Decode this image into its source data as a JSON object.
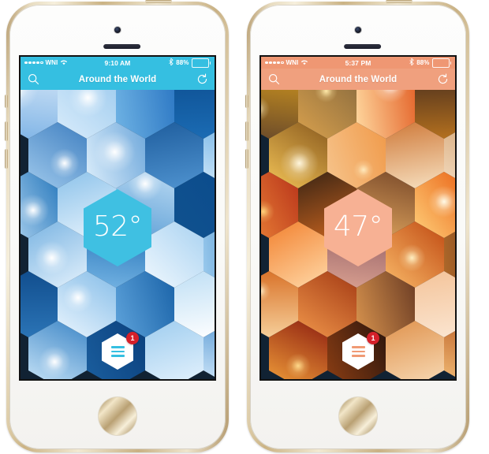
{
  "app": {
    "title": "Around the World",
    "search_icon": "search-icon",
    "refresh_icon": "refresh-icon",
    "menu_icon": "hamburger-menu-icon",
    "badge_count": "1"
  },
  "phones": [
    {
      "id": "phone-left-blue",
      "theme": "daytime-blue",
      "accent": "#31bde0",
      "navbar_color": "#35bfe1",
      "statusbar_color": "#35bfe1",
      "status": {
        "signal_dots": [
          true,
          true,
          true,
          true,
          false
        ],
        "carrier": "WNI",
        "wifi_icon": "wifi-icon",
        "time": "9:10 AM",
        "bluetooth_icon": "bluetooth-icon",
        "battery_percent": "88%",
        "battery_level": 88
      },
      "title": "Around the World",
      "temperature": "52°",
      "temp_badge_color": "#3fc0e2",
      "menu_bar_color": "#35bfe1",
      "badge_count": "1",
      "badge_color": "#d5202a",
      "tiles": [
        {
          "name": "sun-flare-tile",
          "c1": "#cfe3f6",
          "c2": "#7fb4e6",
          "sun": "28% 24%",
          "sunsize": 40,
          "suncolor": "#ffffff"
        },
        {
          "name": "bright-sun-cloud-tile",
          "c1": "#9ecbee",
          "c2": "#d9ecfb",
          "sun": "52% 38%",
          "sunsize": 34,
          "suncolor": "#ffffff"
        },
        {
          "name": "blue-sky-clouds-tile",
          "c1": "#2d78c4",
          "c2": "#6fb3e4",
          "sun": "",
          "sunsize": 0,
          "suncolor": "#ffffff"
        },
        {
          "name": "deep-blue-tile",
          "c1": "#0d4f92",
          "c2": "#1b6cb4",
          "sun": "",
          "sunsize": 0,
          "suncolor": "#ffffff"
        },
        {
          "name": "sunburst-cloud-tile",
          "c1": "#3f7fc0",
          "c2": "#9fc9ec",
          "sun": "62% 62%",
          "sunsize": 26,
          "suncolor": "#ffffff"
        },
        {
          "name": "sun-behind-cloud-tile",
          "c1": "#6fa8db",
          "c2": "#dceefb",
          "sun": "48% 45%",
          "sunsize": 36,
          "suncolor": "#ffffff"
        },
        {
          "name": "dark-cloud-sky-tile",
          "c1": "#1f5e9e",
          "c2": "#4f93d0",
          "sun": "",
          "sunsize": 0,
          "suncolor": "#ffffff"
        },
        {
          "name": "wispy-cloud-tile",
          "c1": "#63a9e0",
          "c2": "#cfe8fa",
          "sun": "",
          "sunsize": 0,
          "suncolor": "#ffffff"
        },
        {
          "name": "sun-rays-tile",
          "c1": "#2a7abd",
          "c2": "#bcdcf5",
          "sun": "58% 58%",
          "sunsize": 28,
          "suncolor": "#ffffff"
        },
        {
          "name": "cloud-field-tile",
          "c1": "#8cc2ea",
          "c2": "#e8f4fd",
          "sun": "",
          "sunsize": 0,
          "suncolor": "#ffffff"
        },
        {
          "name": "gradient-sky-tile",
          "c1": "#b9d9f2",
          "c2": "#5d9fd6",
          "sun": "50% 18%",
          "sunsize": 30,
          "suncolor": "#ffffff"
        },
        {
          "name": "navy-block-tile",
          "c1": "#0b4b8c",
          "c2": "#10528f",
          "sun": "",
          "sunsize": 0,
          "suncolor": "#ffffff"
        },
        {
          "name": "sunshine-cloud-tile",
          "c1": "#7ab4e2",
          "c2": "#e3f1fc",
          "sun": "40% 55%",
          "sunsize": 30,
          "suncolor": "#ffffff"
        },
        {
          "name": "clear-blue-tile",
          "c1": "#1f6fb5",
          "c2": "#74b3e3",
          "sun": "",
          "sunsize": 0,
          "suncolor": "#ffffff"
        },
        {
          "name": "soft-cloud-tile",
          "c1": "#a9d2f1",
          "c2": "#f0f8fe",
          "sun": "",
          "sunsize": 0,
          "suncolor": "#ffffff"
        },
        {
          "name": "sky-horizon-tile",
          "c1": "#2f7cbe",
          "c2": "#9ccbee",
          "sun": "70% 35%",
          "sunsize": 24,
          "suncolor": "#ffffff"
        },
        {
          "name": "deep-sky-tile",
          "c1": "#114e8e",
          "c2": "#2b74b6",
          "sun": "",
          "sunsize": 0,
          "suncolor": "#ffffff"
        },
        {
          "name": "cloud-burst-tile",
          "c1": "#86bde8",
          "c2": "#eaf5fe",
          "sun": "35% 40%",
          "sunsize": 26,
          "suncolor": "#ffffff"
        },
        {
          "name": "azure-tile",
          "c1": "#1a63a8",
          "c2": "#5ea3db",
          "sun": "",
          "sunsize": 0,
          "suncolor": "#ffffff"
        },
        {
          "name": "white-cloud-tile",
          "c1": "#bfdff5",
          "c2": "#ffffff",
          "sun": "",
          "sunsize": 0,
          "suncolor": "#ffffff"
        },
        {
          "name": "horizon-glow-tile",
          "c1": "#3d86c6",
          "c2": "#cbe6f9",
          "sun": "45% 62%",
          "sunsize": 28,
          "suncolor": "#ffffff"
        },
        {
          "name": "midnight-blue-tile",
          "c1": "#0a3f7c",
          "c2": "#1b5f9f",
          "sun": "",
          "sunsize": 0,
          "suncolor": "#ffffff"
        },
        {
          "name": "pale-sky-tile",
          "c1": "#9fcdef",
          "c2": "#e6f3fd",
          "sun": "",
          "sunsize": 0,
          "suncolor": "#ffffff"
        },
        {
          "name": "sunlit-cloud-tile",
          "c1": "#4b90ce",
          "c2": "#d4eafb",
          "sun": "60% 30%",
          "sunsize": 22,
          "suncolor": "#ffffff"
        }
      ]
    },
    {
      "id": "phone-right-orange",
      "theme": "sunset-orange",
      "accent": "#f0906a",
      "navbar_color": "#f0a07e",
      "statusbar_color": "#ef9773",
      "status": {
        "signal_dots": [
          true,
          true,
          true,
          true,
          false
        ],
        "carrier": "WNI",
        "wifi_icon": "wifi-icon",
        "time": "5:37 PM",
        "bluetooth_icon": "bluetooth-icon",
        "battery_percent": "88%",
        "battery_level": 88
      },
      "title": "Around the World",
      "temperature": "47°",
      "temp_badge_color": "#f7b194",
      "menu_bar_color": "#f09a74",
      "badge_count": "1",
      "badge_color": "#d5202a",
      "tiles": [
        {
          "name": "palm-sunset-tile",
          "c1": "#c9911f",
          "c2": "#6a4a2a",
          "sun": "30% 55%",
          "sunsize": 22,
          "suncolor": "#fff3c8"
        },
        {
          "name": "pier-sunset-tile",
          "c1": "#8a6b3e",
          "c2": "#d9a14d",
          "sun": "48% 28%",
          "sunsize": 20,
          "suncolor": "#ffe9a8"
        },
        {
          "name": "ocean-sunburst-tile",
          "c1": "#e4642a",
          "c2": "#ffd9a0",
          "sun": "58% 18%",
          "sunsize": 32,
          "suncolor": "#ffffff"
        },
        {
          "name": "dark-palm-tile",
          "c1": "#4b2f1d",
          "c2": "#b5711f",
          "sun": "",
          "sunsize": 0,
          "suncolor": "#ffffff"
        },
        {
          "name": "golden-sun-tile",
          "c1": "#8a5a1e",
          "c2": "#f2c356",
          "sun": "52% 62%",
          "sunsize": 34,
          "suncolor": "#fff6dd"
        },
        {
          "name": "amber-sky-tile",
          "c1": "#f09a4a",
          "c2": "#f6c48c",
          "sun": "62% 72%",
          "sunsize": 18,
          "suncolor": "#ffe9bc"
        },
        {
          "name": "cloud-fire-tile",
          "c1": "#cf7a3a",
          "c2": "#f7e0c0",
          "sun": "",
          "sunsize": 0,
          "suncolor": "#ffffff"
        },
        {
          "name": "beach-dusk-tile",
          "c1": "#d0a070",
          "c2": "#f4dcc0",
          "sun": "",
          "sunsize": 0,
          "suncolor": "#ffffff"
        },
        {
          "name": "red-horizon-tile",
          "c1": "#b8341a",
          "c2": "#ef8a3a",
          "sun": "40% 60%",
          "sunsize": 20,
          "suncolor": "#ffd27a"
        },
        {
          "name": "palm-silhouette-tile",
          "c1": "#3a2414",
          "c2": "#c9641f",
          "sun": "68% 78%",
          "sunsize": 22,
          "suncolor": "#ffc96a"
        },
        {
          "name": "dusk-water-tile",
          "c1": "#7a4a2a",
          "c2": "#e0a55e",
          "sun": "",
          "sunsize": 0,
          "suncolor": "#ffffff"
        },
        {
          "name": "blazing-sun-tile",
          "c1": "#e85c10",
          "c2": "#ffd07a",
          "sun": "50% 45%",
          "sunsize": 28,
          "suncolor": "#fffbe8"
        },
        {
          "name": "orange-glow-tile",
          "c1": "#f2812f",
          "c2": "#ffd9a8",
          "sun": "",
          "sunsize": 0,
          "suncolor": "#ffffff"
        },
        {
          "name": "mauve-dusk-tile",
          "c1": "#8e5a62",
          "c2": "#d9a090",
          "sun": "",
          "sunsize": 0,
          "suncolor": "#ffffff"
        },
        {
          "name": "sunset-sea-tile",
          "c1": "#c04a12",
          "c2": "#f9b968",
          "sun": "45% 55%",
          "sunsize": 24,
          "suncolor": "#ffeec0"
        },
        {
          "name": "twilight-tile",
          "c1": "#5e2f1c",
          "c2": "#b06a2a",
          "sun": "",
          "sunsize": 0,
          "suncolor": "#ffffff"
        },
        {
          "name": "copper-sky-tile",
          "c1": "#d9732a",
          "c2": "#f6cf9a",
          "sun": "35% 30%",
          "sunsize": 18,
          "suncolor": "#fff2cc"
        },
        {
          "name": "ember-cloud-tile",
          "c1": "#a33a14",
          "c2": "#f0964a",
          "sun": "",
          "sunsize": 0,
          "suncolor": "#ffffff"
        },
        {
          "name": "lagoon-dusk-tile",
          "c1": "#6b3c24",
          "c2": "#d9944e",
          "sun": "",
          "sunsize": 0,
          "suncolor": "#ffffff"
        },
        {
          "name": "pale-peach-tile",
          "c1": "#f4c49a",
          "c2": "#fbe6d2",
          "sun": "",
          "sunsize": 0,
          "suncolor": "#ffffff"
        },
        {
          "name": "crimson-set-tile",
          "c1": "#8e1f10",
          "c2": "#f2a03a",
          "sun": "50% 68%",
          "sunsize": 22,
          "suncolor": "#ffd98a"
        },
        {
          "name": "night-ocean-tile",
          "c1": "#2a140c",
          "c2": "#8e3f14",
          "sun": "",
          "sunsize": 0,
          "suncolor": "#ffffff"
        },
        {
          "name": "warm-haze-tile",
          "c1": "#e0934e",
          "c2": "#f8dcb8",
          "sun": "",
          "sunsize": 0,
          "suncolor": "#ffffff"
        },
        {
          "name": "last-light-tile",
          "c1": "#b85a22",
          "c2": "#f4c07a",
          "sun": "58% 40%",
          "sunsize": 20,
          "suncolor": "#ffeec0"
        }
      ]
    }
  ]
}
